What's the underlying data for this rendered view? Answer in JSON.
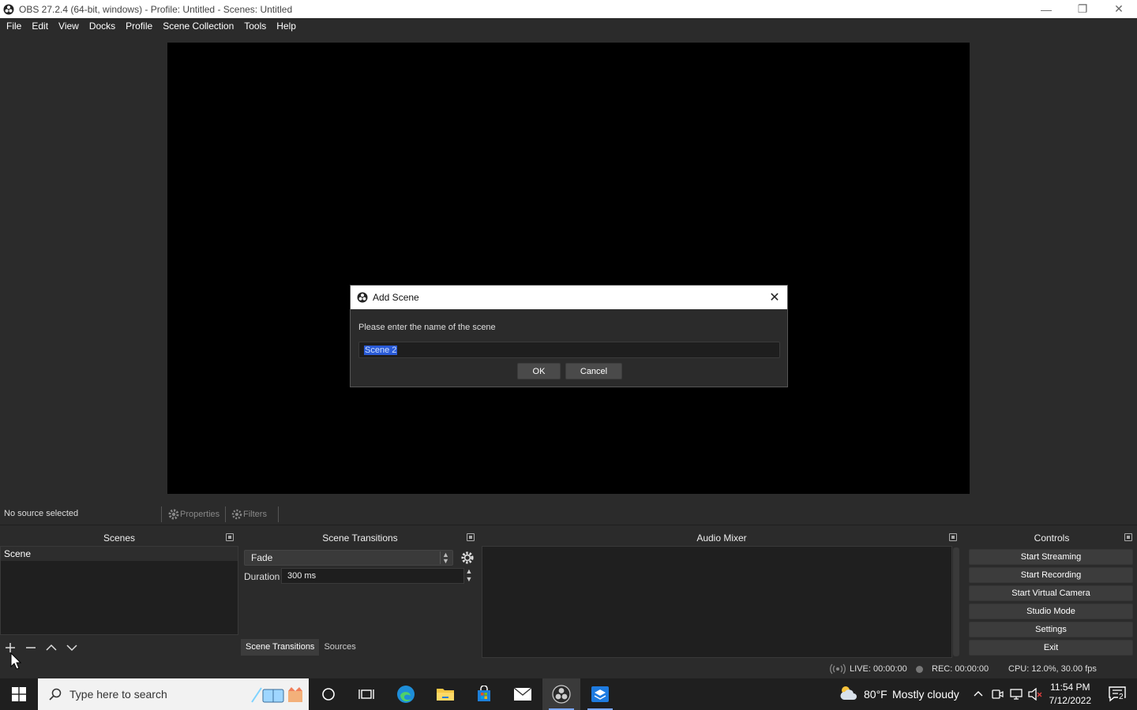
{
  "window": {
    "title": "OBS 27.2.4 (64-bit, windows) - Profile: Untitled - Scenes: Untitled",
    "minimize": "—",
    "restore": "❐",
    "close": "✕"
  },
  "menu": [
    "File",
    "Edit",
    "View",
    "Docks",
    "Profile",
    "Scene Collection",
    "Tools",
    "Help"
  ],
  "dialog": {
    "title": "Add Scene",
    "prompt": "Please enter the name of the scene",
    "input_value": "Scene 2",
    "ok": "OK",
    "cancel": "Cancel",
    "close": "✕"
  },
  "source_toolbar": {
    "status": "No source selected",
    "properties": "Properties",
    "filters": "Filters"
  },
  "scenes": {
    "title": "Scenes",
    "items": [
      "Scene"
    ]
  },
  "transitions": {
    "title": "Scene Transitions",
    "selected": "Fade",
    "duration_label": "Duration",
    "duration_value": "300 ms",
    "tabs": [
      "Scene Transitions",
      "Sources"
    ]
  },
  "mixer": {
    "title": "Audio Mixer"
  },
  "controls": {
    "title": "Controls",
    "buttons": [
      "Start Streaming",
      "Start Recording",
      "Start Virtual Camera",
      "Studio Mode",
      "Settings",
      "Exit"
    ]
  },
  "status": {
    "live": "LIVE: 00:00:00",
    "rec": "REC: 00:00:00",
    "cpu": "CPU: 12.0%, 30.00 fps"
  },
  "taskbar": {
    "search_placeholder": "Type here to search",
    "weather_temp": "80°F",
    "weather_desc": "Mostly cloudy",
    "time": "11:54 PM",
    "date": "7/12/2022",
    "notifications": "2"
  }
}
